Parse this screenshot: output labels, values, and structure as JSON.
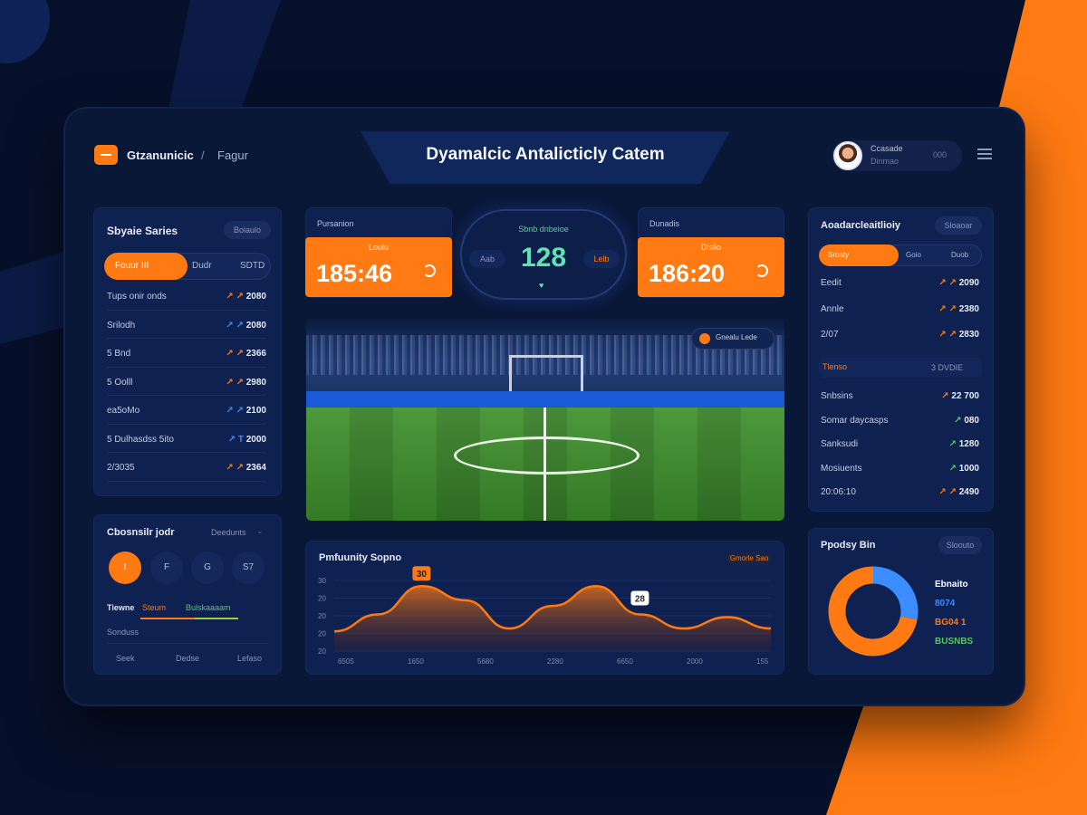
{
  "header": {
    "brand": "Gtzanunicic",
    "separator": "/",
    "breadcrumb": "Fagur",
    "title": "Dyamalcic Antalicticly Catem",
    "user": {
      "name": "Ccasade",
      "role": "Dinmao",
      "count": "000"
    }
  },
  "left_series": {
    "title": "Sbyaie Saries",
    "chip": "Boiaulo",
    "tabs": [
      "Fouur III",
      "Dudr",
      "SDTD"
    ],
    "rows": [
      {
        "label": "Tups onir onds",
        "prefix": "↗ ↗",
        "value": "2080",
        "color": "o"
      },
      {
        "label": "Srilodh",
        "prefix": "↗ ↗",
        "value": "2080",
        "color": "b"
      },
      {
        "label": "5 Bnd",
        "prefix": "↗ ↗",
        "value": "2366",
        "color": "o"
      },
      {
        "label": "5 Oolll",
        "prefix": "↗ ↗",
        "value": "2980",
        "color": "o"
      },
      {
        "label": "ea5oMo",
        "prefix": "↗ ↗",
        "value": "2100",
        "color": "b"
      },
      {
        "label": "5 Dulhasdss 5ito",
        "prefix": "↗ T",
        "value": "2000",
        "color": "b"
      },
      {
        "label": "2/3035",
        "prefix": "↗ ↗",
        "value": "2364",
        "color": "o"
      }
    ]
  },
  "left_lower": {
    "title": "Cbosnsilr jodr",
    "chip": "Deedunts",
    "buttons": [
      "I",
      "F",
      "G",
      "S7"
    ],
    "legend_left": "Tiewne",
    "legend_orange": "Steum",
    "legend_green": "Bulskaaaam",
    "sub_label": "Sonduss",
    "ticks": [
      "Seek",
      "Dedse",
      "Lefaso"
    ]
  },
  "score": {
    "left": {
      "header": "Pursanion",
      "label": "Loulu",
      "value": "185:46"
    },
    "right": {
      "header": "Dunadis",
      "label": "Dislio",
      "value": "186:20"
    },
    "center": {
      "label": "Sbnb dnbeioe",
      "value": "128",
      "left_chip": "Aab",
      "right_chip": "Lelb"
    }
  },
  "field": {
    "badge": "Gnealu Lede"
  },
  "chart": {
    "title": "Pmfuunity Sopno",
    "chip": "Gmorle Sao",
    "badge_1": "30",
    "badge_2": "28"
  },
  "chart_data": {
    "type": "area",
    "title": "Pmfuunity Sopno",
    "x": [
      "6505",
      "1650",
      "5680",
      "2280",
      "6650",
      "2000",
      "155"
    ],
    "y_ticks": [
      "20",
      "20",
      "20",
      "20",
      "30"
    ],
    "series": [
      {
        "values": [
          22,
          28,
          38,
          33,
          23,
          31,
          38,
          28,
          23,
          27,
          23
        ]
      }
    ],
    "annotations": [
      {
        "label": "30"
      },
      {
        "label": "28"
      }
    ],
    "series_color": "#ff7a12"
  },
  "right_panel": {
    "title": "Aoadarcleaitlioiy",
    "chip": "Sloaoar",
    "tabs": [
      "Sroaty",
      "Goio",
      "Duob"
    ],
    "rows_top": [
      {
        "label": "Eedit",
        "prefix": "↗ ↗",
        "value": "2090",
        "color": "o"
      },
      {
        "label": "Annle",
        "prefix": "↗ ↗",
        "value": "2380",
        "color": "o"
      },
      {
        "label": "2/07",
        "prefix": "↗ ↗",
        "value": "2830",
        "color": "o"
      }
    ],
    "section_left": "Tlenso",
    "section_right": "3 DVDIE",
    "rows_bottom": [
      {
        "label": "Snbsins",
        "prefix": "↗",
        "value": "22 700",
        "color": "o"
      },
      {
        "label": "Somar daycasps",
        "prefix": "↗",
        "value": "080",
        "color": "g"
      },
      {
        "label": "Sanksudi",
        "prefix": "↗",
        "value": "1280",
        "color": "g"
      },
      {
        "label": "Mosiuents",
        "prefix": "↗",
        "value": "1000",
        "color": "g"
      },
      {
        "label": "20:06:10",
        "prefix": "↗ ↗",
        "value": "2490",
        "color": "o"
      }
    ]
  },
  "donut": {
    "title": "Ppodsy Bin",
    "chip": "Sloouto",
    "legend": [
      {
        "label": "Ebnaito",
        "color": "#ffffff"
      },
      {
        "label": "8074",
        "color": "#3c8dff"
      },
      {
        "label": "BG04 1",
        "color": "#ff7a12"
      },
      {
        "label": "BUSNBS",
        "color": "#58c95a"
      }
    ],
    "slices": [
      0.28,
      0.72
    ],
    "slice_colors": [
      "#3c8dff",
      "#ff7a12"
    ]
  }
}
